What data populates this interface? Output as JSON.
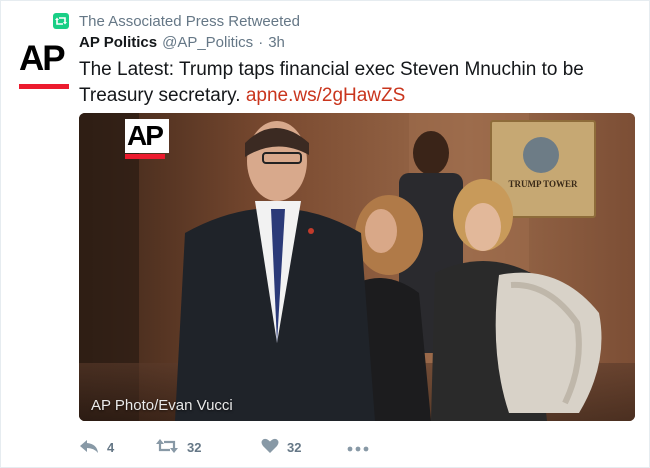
{
  "retweet": {
    "label": "The Associated Press Retweeted",
    "icon": "retweet-icon",
    "color": "#19cf86"
  },
  "author": {
    "name": "AP Politics",
    "handle": "@AP_Politics",
    "separator": "·",
    "time": "3h",
    "avatar_text": "AP"
  },
  "tweet": {
    "text": "The Latest: Trump taps financial exec Steven Mnuchin to be Treasury secretary.",
    "link": "apne.ws/2gHawZS",
    "link_color": "#c9351d"
  },
  "photo": {
    "logo_text": "AP",
    "sign_text": "TRUMP TOWER",
    "credit": "AP Photo/Evan Vucci"
  },
  "actions": {
    "reply": {
      "icon": "reply-icon",
      "count": "4"
    },
    "retweet": {
      "icon": "retweet-icon",
      "count": "32"
    },
    "like": {
      "icon": "heart-icon",
      "count": "32"
    },
    "more": {
      "icon": "more-icon"
    }
  }
}
